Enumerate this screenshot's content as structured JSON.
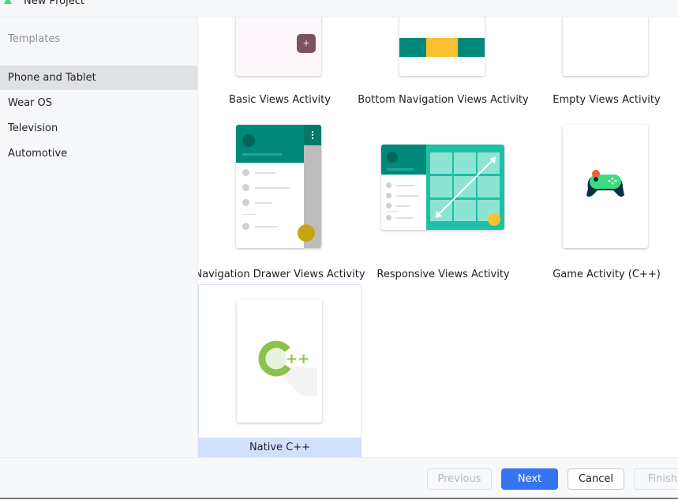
{
  "window": {
    "title": "New Project"
  },
  "sidebar": {
    "heading": "Templates",
    "items": [
      {
        "label": "Phone and Tablet",
        "selected": true
      },
      {
        "label": "Wear OS",
        "selected": false
      },
      {
        "label": "Television",
        "selected": false
      },
      {
        "label": "Automotive",
        "selected": false
      }
    ]
  },
  "templates": [
    {
      "label": "Basic Views Activity",
      "fab_glyph": "+"
    },
    {
      "label": "Bottom Navigation Views Activity"
    },
    {
      "label": "Empty Views Activity"
    },
    {
      "label": "Navigation Drawer Views Activity"
    },
    {
      "label": "Responsive Views Activity"
    },
    {
      "label": "Game Activity (C++)"
    },
    {
      "label": "Native C++",
      "selected": true,
      "logo_text": "++"
    }
  ],
  "footer": {
    "previous_label": "Previous",
    "next_label": "Next",
    "cancel_label": "Cancel",
    "finish_label": "Finish"
  },
  "colors": {
    "teal": "#00897b",
    "teal_light": "#1ebfa5",
    "accent_yellow": "#fbc02d",
    "primary_button": "#3574f0",
    "selection": "#d3e0fb",
    "cpp_green": "#8bc34a"
  }
}
